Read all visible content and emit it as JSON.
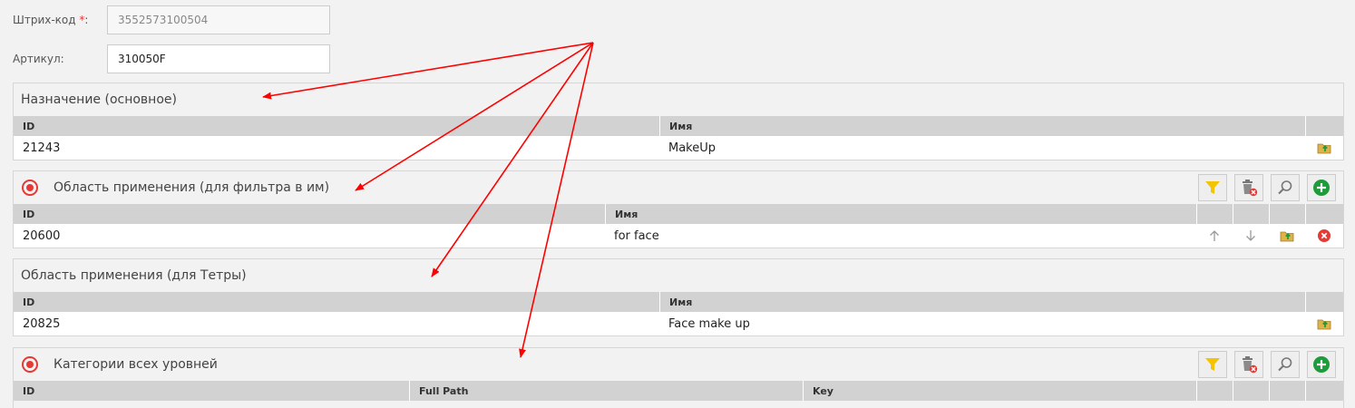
{
  "form": {
    "barcode_label": "Штрих-код",
    "barcode_required_mark": "*",
    "barcode_colon": ":",
    "barcode_value": "3552573100504",
    "article_label": "Артикул:",
    "article_value": "310050F"
  },
  "panels": [
    {
      "title": "Назначение (основное)",
      "columns": [
        "ID",
        "Имя"
      ],
      "rows": [
        {
          "id": "21243",
          "name": "MakeUp"
        }
      ]
    },
    {
      "title": "Область применения (для фильтра в им)",
      "columns": [
        "ID",
        "Имя"
      ],
      "rows": [
        {
          "id": "20600",
          "name": "for face"
        }
      ]
    },
    {
      "title": "Область применения (для Тетры)",
      "columns": [
        "ID",
        "Имя"
      ],
      "rows": [
        {
          "id": "20825",
          "name": "Face make up"
        }
      ]
    },
    {
      "title": "Категории всех уровней",
      "columns": [
        "ID",
        "Full Path",
        "Key"
      ],
      "rows": []
    }
  ],
  "icons": {
    "target": "target-icon",
    "filter": "filter-icon",
    "delete_all": "trash-delete-icon",
    "search": "search-icon",
    "add": "add-icon",
    "up": "arrow-up-icon",
    "down": "arrow-down-icon",
    "open": "folder-open-icon",
    "remove": "remove-icon"
  },
  "colors": {
    "accent_red": "#e53935",
    "filter_yellow": "#f5c400",
    "add_green": "#1e9b3a",
    "header_gray": "#d2d2d2",
    "annotation_arrow": "#ff0000"
  }
}
